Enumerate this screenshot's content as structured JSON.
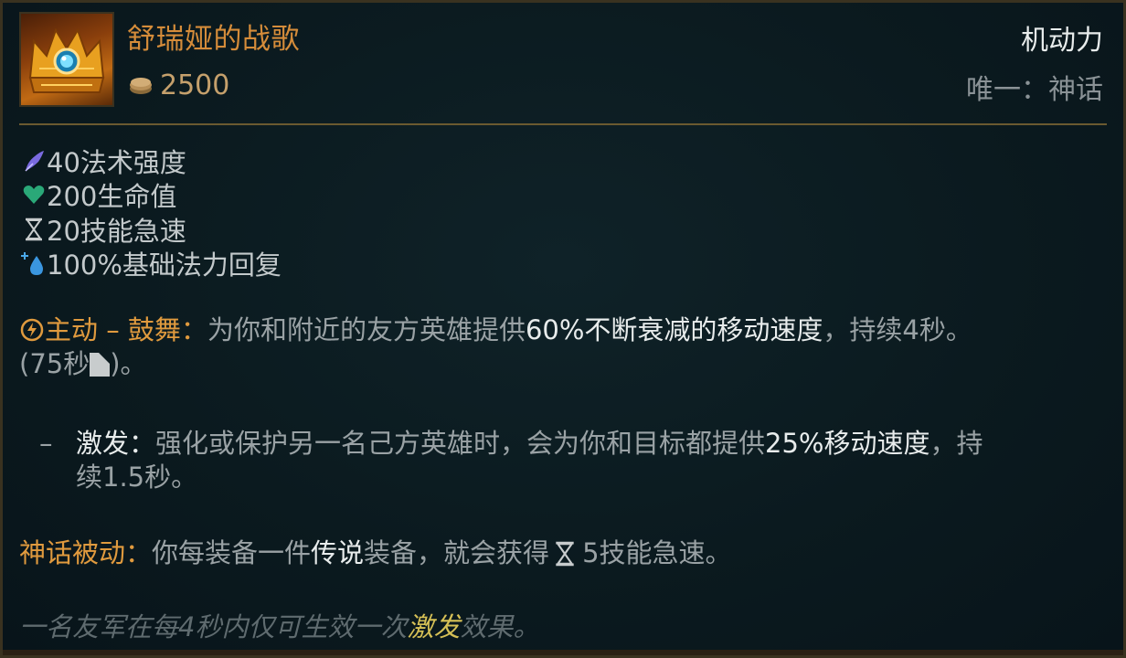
{
  "item": {
    "name": "舒瑞娅的战歌",
    "cost": "2500",
    "icon": "crown-icon",
    "category": "机动力",
    "unique": "唯一：神话"
  },
  "stats": [
    {
      "icon": "ability-power-icon",
      "text": "40法术强度"
    },
    {
      "icon": "health-icon",
      "text": "200生命值"
    },
    {
      "icon": "ability-haste-icon",
      "text": "20技能急速"
    },
    {
      "icon": "mana-regen-icon",
      "text": "100%基础法力回复"
    }
  ],
  "active": {
    "label": "主动 – 鼓舞：",
    "text_a": "为你和附近的友方英雄提供",
    "highlight": "60%不断衰减的移动速度",
    "text_b": "，持续4秒。",
    "cooldown_open": "(75秒",
    "cooldown_close": ")。"
  },
  "energize": {
    "dash": "–",
    "label": "激发：",
    "text_a": "强化或保护另一名己方英雄时，会为你和目标都提供",
    "highlight": "25%移动速度",
    "text_b": "，持",
    "line2": "续1.5秒。"
  },
  "mythic": {
    "label": "神话被动：",
    "text_a": "你每装备一件",
    "highlight": "传说",
    "text_b": "装备，就会获得",
    "text_c": "5技能急速。"
  },
  "flavor": {
    "text_a": "一名友军在每4秒内仅可生效一次",
    "highlight": "激发",
    "text_b": "效果。"
  },
  "colors": {
    "name": "#d58c3a",
    "label_gold": "#e09a3e",
    "highlight_white": "#e8ecec",
    "highlight_yellow": "#e3c85a",
    "body": "#9aa2a5",
    "divider": "#6b5a30"
  }
}
